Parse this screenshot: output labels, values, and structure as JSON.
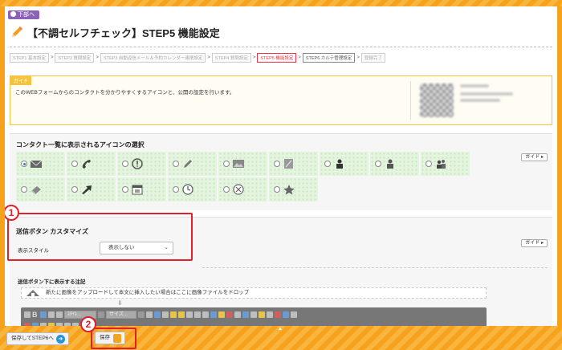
{
  "header": {
    "prev_badge": "下部へ",
    "title": "【不調セルフチェック】STEP5 機能設定"
  },
  "steps": [
    {
      "label": "STEP1 基本設定",
      "state": "done"
    },
    {
      "label": "STEP2 質問設定",
      "state": "done"
    },
    {
      "label": "STEP3 自動返信メール＆予約カレンダー連携設定",
      "state": "done"
    },
    {
      "label": "STEP4 質問設定",
      "state": "done"
    },
    {
      "label": "STEP5 機能設定",
      "state": "current"
    },
    {
      "label": "STEP6 カルテ管理設定",
      "state": "next"
    },
    {
      "label": "登録完了",
      "state": "todo"
    }
  ],
  "guide": {
    "tag": "ガイド",
    "text": "このWEBフォームからのコンタクトを分かりやすくするアイコンと、公開の設定を行います。"
  },
  "icon_section": {
    "title": "コンタクト一覧に表示されるアイコンの選択",
    "guide_button": "ガイド",
    "icons": [
      {
        "name": "mail-icon",
        "selected": true
      },
      {
        "name": "phone-icon",
        "selected": false
      },
      {
        "name": "exclamation-icon",
        "selected": false
      },
      {
        "name": "pencil-icon",
        "selected": false
      },
      {
        "name": "image-icon",
        "selected": false
      },
      {
        "name": "note-icon",
        "selected": false
      },
      {
        "name": "person-icon",
        "selected": false
      },
      {
        "name": "person-alt-icon",
        "selected": false
      },
      {
        "name": "people-icon",
        "selected": false
      },
      {
        "name": "book-icon",
        "selected": false
      },
      {
        "name": "arrow-icon",
        "selected": false
      },
      {
        "name": "calendar-icon",
        "selected": false
      },
      {
        "name": "clock-icon",
        "selected": false
      },
      {
        "name": "cross-circle-icon",
        "selected": false
      },
      {
        "name": "star-icon",
        "selected": false
      }
    ]
  },
  "submit_section": {
    "title": "送信ボタン カスタマイズ",
    "guide_button": "ガイド",
    "style_label": "表示スタイル",
    "style_value": "表示しない",
    "note_label": "送信ボタン下に表示する注記",
    "dropzone_text": "新たに画像をアップロードして本文に挿入したい場合はここに画像ファイルをドロップ",
    "editor_font_select": "ｽﾀｲﾙ...",
    "editor_size_select": "サイズ..."
  },
  "callouts": {
    "one": "1",
    "two": "2"
  },
  "footer": {
    "save_next_label": "保存してSTEP6へ",
    "save_label": "保存"
  },
  "colors": {
    "frame": "#f6a21c",
    "callout": "#e0202a",
    "icon_cell": "#e4f4df",
    "guide_border": "#f4c33f",
    "current_step": "#e34"
  }
}
